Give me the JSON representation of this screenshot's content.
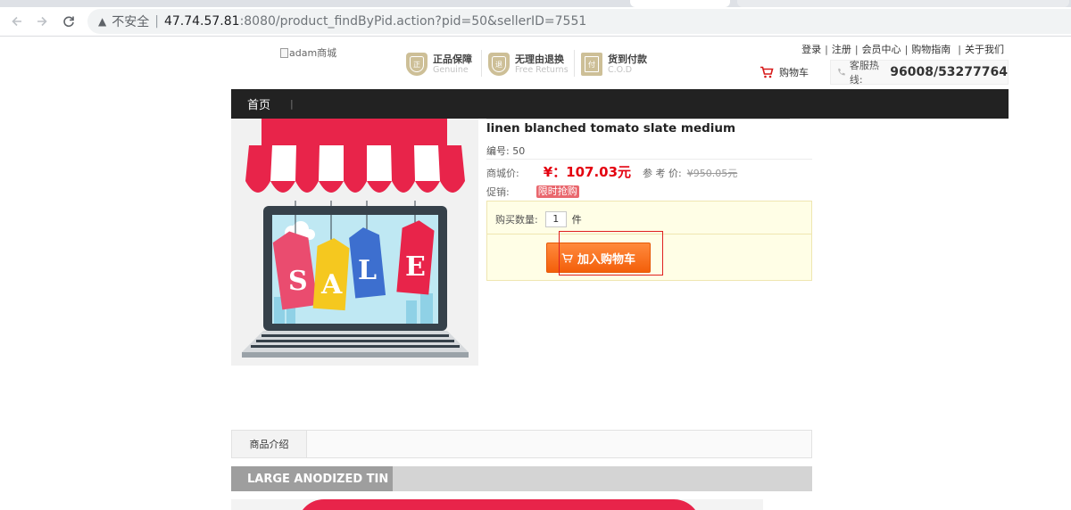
{
  "browser": {
    "insecure_label": "不安全",
    "url_host": "47.74.57.81",
    "url_path": ":8080/product_findByPid.action?pid=50&sellerID=7551"
  },
  "header": {
    "logo_alt": "adam商城",
    "assurances": [
      {
        "cn": "正品保障",
        "en": "Genuine",
        "icon": "genuine-badge-icon"
      },
      {
        "cn": "无理由退换",
        "en": "Free Returns",
        "icon": "return-badge-icon"
      },
      {
        "cn": "货到付款",
        "en": "C.O.D",
        "icon": "cod-badge-icon"
      }
    ],
    "links": [
      "登录",
      "注册",
      "会员中心",
      "购物指南",
      "关于我们"
    ],
    "cart_label": "购物车",
    "hotline_label": "客服热线:",
    "hotline_number": "96008/53277764"
  },
  "nav": {
    "home": "首页",
    "separator": "|"
  },
  "product": {
    "name": "linen blanched tomato slate medium",
    "number_label": "编号:",
    "number": "50",
    "price_label": "商城价:",
    "price": "¥：107.03元",
    "ref_label": "参 考 价:",
    "ref_price": "¥950.05元",
    "promo_label": "促销:",
    "promo_tag": "限时抢购",
    "image_text": "SALE",
    "qty_label": "购买数量:",
    "qty_value": "1",
    "qty_unit": "件",
    "add_to_cart": "加入购物车"
  },
  "tabs": {
    "intro": "商品介绍"
  },
  "section": {
    "title": "LARGE ANODIZED TIN"
  },
  "colors": {
    "nav_bg": "#222222",
    "price_red": "#e4000f",
    "button_orange": "#f36d16",
    "highlight": "#e02020",
    "buybox_bg": "#fffee6"
  }
}
